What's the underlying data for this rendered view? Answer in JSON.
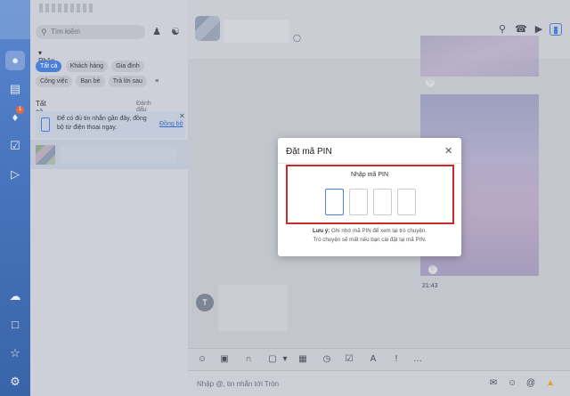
{
  "contacts": {
    "search_placeholder": "Tìm kiếm",
    "classify_label": "Phân loại",
    "chips": [
      "Tất cả",
      "Khách hàng",
      "Gia đình",
      "Công việc",
      "Bạn bè",
      "Trả lời sau"
    ],
    "all_messages": "Tất cả tin nhắn",
    "mark_read": "Đánh dấu đã đọc",
    "notice_text": "Để có đủ tin nhắn gần đây, đồng bộ từ điện thoại ngay.",
    "notice_sync": "Đồng bộ"
  },
  "rail": {
    "notification_count": "1"
  },
  "chat": {
    "time": "21:43",
    "incoming_avatar_letter": "T",
    "input_placeholder": "Nhập @, tin nhắn tới Tròn"
  },
  "modal": {
    "title": "Đặt mã PIN",
    "prompt": "Nhập mã PIN",
    "note_label": "Lưu ý:",
    "note_line1": "Ghi nhớ mã PIN để xem lại trò chuyện.",
    "note_line2": "Trò chuyện sẽ mất nếu bạn cài đặt lại mã PIN."
  },
  "colors": {
    "accent": "#4c7fd6",
    "highlight": "#cc2a2a"
  }
}
